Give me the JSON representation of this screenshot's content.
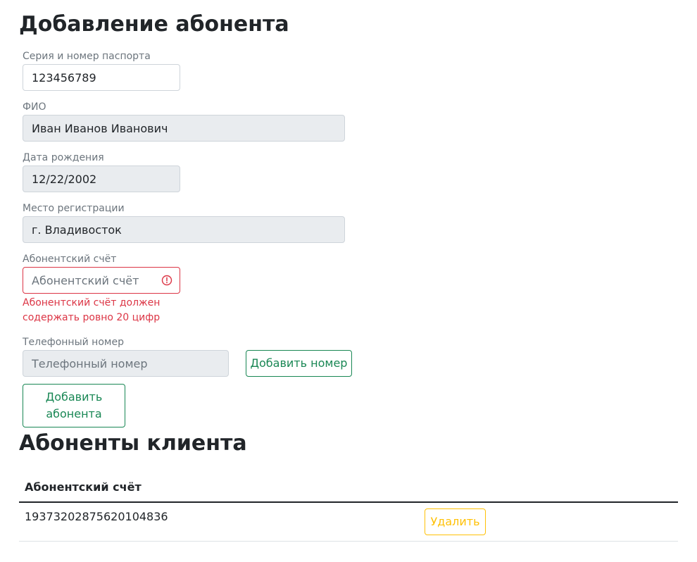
{
  "form": {
    "title": "Добавление абонента",
    "passport": {
      "label": "Серия и номер паспорта",
      "value": "123456789"
    },
    "fio": {
      "label": "ФИО",
      "value": "Иван Иванов Иванович"
    },
    "birth_date": {
      "label": "Дата рождения",
      "value": "12/22/2002"
    },
    "registration": {
      "label": "Место регистрации",
      "value": "г. Владивосток"
    },
    "account": {
      "label": "Абонентский счёт",
      "value": "",
      "placeholder": "Абонентский счёт",
      "error": "Абонентский счёт должен содержать ровно 20 цифр"
    },
    "phone": {
      "label": "Телефонный номер",
      "value": "",
      "placeholder": "Телефонный номер",
      "add_button": "Добавить номер"
    },
    "submit_button": "Добавить абонента"
  },
  "subscribers": {
    "title": "Абоненты клиента",
    "columns": [
      "Абонентский счёт"
    ],
    "rows": [
      {
        "account": "19373202875620104836",
        "delete_label": "Удалить"
      }
    ]
  },
  "colors": {
    "success": "#198754",
    "danger": "#dc3545",
    "warning": "#ffc107",
    "readonly_bg": "#e9ecef"
  }
}
